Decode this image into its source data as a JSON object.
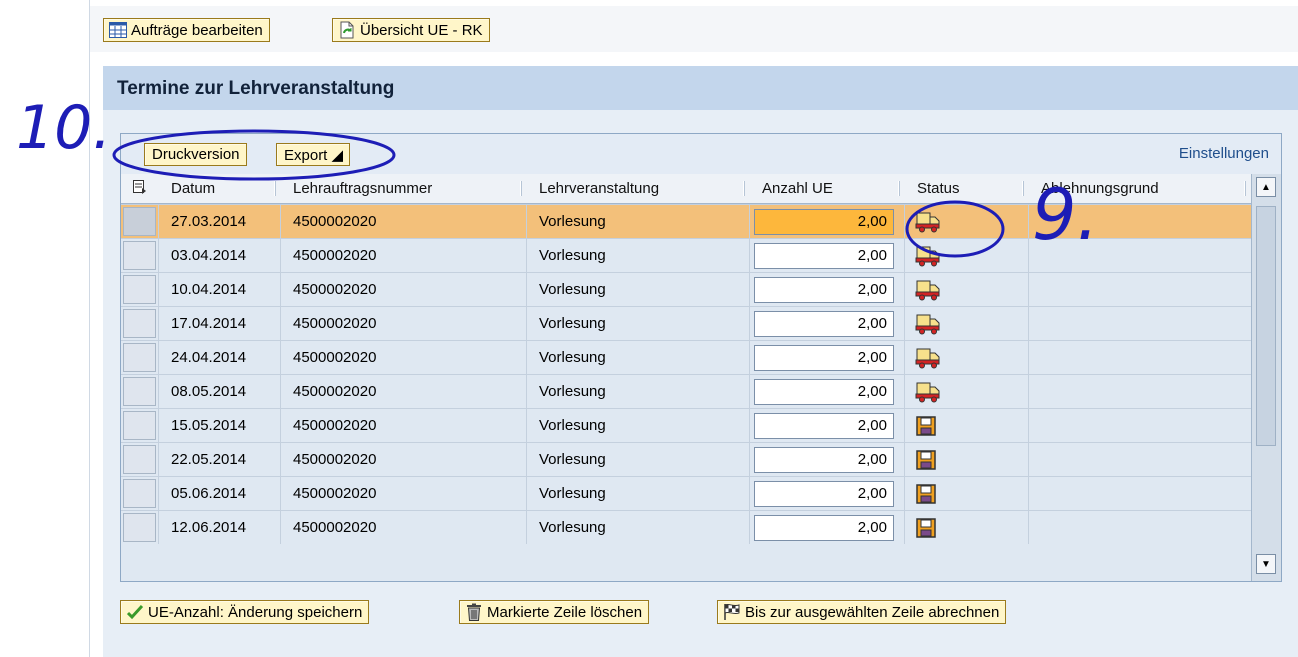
{
  "toolbar": {
    "edit_orders": "Aufträge bearbeiten",
    "overview": "Übersicht UE - RK"
  },
  "panel": {
    "title": "Termine zur Lehrveranstaltung",
    "print_version": "Druckversion",
    "export": "Export ◢",
    "settings": "Einstellungen"
  },
  "table": {
    "columns": [
      "Datum",
      "Lehrauftragsnummer",
      "Lehrveranstaltung",
      "Anzahl UE",
      "Status",
      "Ablehnungsgrund"
    ],
    "rows": [
      {
        "date": "27.03.2014",
        "number": "4500002020",
        "course": "Vorlesung",
        "ue": "2,00",
        "status": "truck-icon",
        "reason": ""
      },
      {
        "date": "03.04.2014",
        "number": "4500002020",
        "course": "Vorlesung",
        "ue": "2,00",
        "status": "truck-icon",
        "reason": ""
      },
      {
        "date": "10.04.2014",
        "number": "4500002020",
        "course": "Vorlesung",
        "ue": "2,00",
        "status": "truck-icon",
        "reason": ""
      },
      {
        "date": "17.04.2014",
        "number": "4500002020",
        "course": "Vorlesung",
        "ue": "2,00",
        "status": "truck-icon",
        "reason": ""
      },
      {
        "date": "24.04.2014",
        "number": "4500002020",
        "course": "Vorlesung",
        "ue": "2,00",
        "status": "truck-icon",
        "reason": ""
      },
      {
        "date": "08.05.2014",
        "number": "4500002020",
        "course": "Vorlesung",
        "ue": "2,00",
        "status": "truck-icon",
        "reason": ""
      },
      {
        "date": "15.05.2014",
        "number": "4500002020",
        "course": "Vorlesung",
        "ue": "2,00",
        "status": "save-icon",
        "reason": ""
      },
      {
        "date": "22.05.2014",
        "number": "4500002020",
        "course": "Vorlesung",
        "ue": "2,00",
        "status": "save-icon",
        "reason": ""
      },
      {
        "date": "05.06.2014",
        "number": "4500002020",
        "course": "Vorlesung",
        "ue": "2,00",
        "status": "save-icon",
        "reason": ""
      },
      {
        "date": "12.06.2014",
        "number": "4500002020",
        "course": "Vorlesung",
        "ue": "2,00",
        "status": "save-icon",
        "reason": ""
      }
    ],
    "selected_row": 0
  },
  "footer": {
    "save_ue": "UE-Anzahl: Änderung speichern",
    "delete_row": "Markierte Zeile löschen",
    "settle_until": "Bis zur ausgewählten Zeile abrechnen"
  },
  "annotations": {
    "ten": "10.",
    "nine": "9."
  },
  "colors": {
    "selected_row": "#f3c07a",
    "accent_blue": "#1d1db6",
    "button_bg": "#fff6c9"
  }
}
